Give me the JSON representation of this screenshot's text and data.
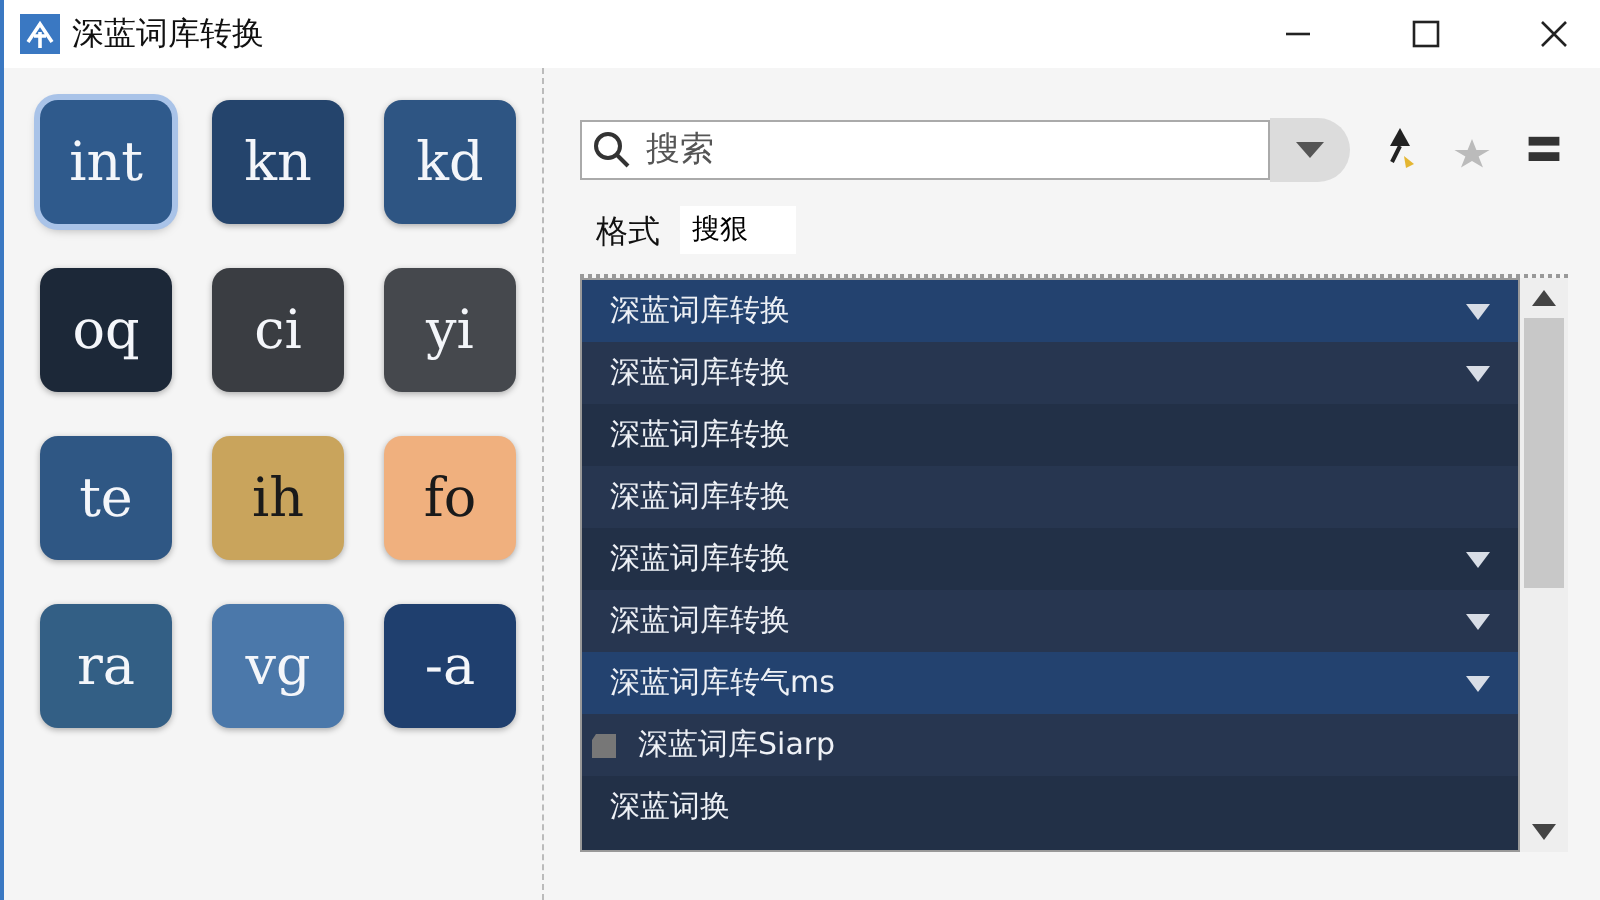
{
  "window": {
    "title": "深蓝词库转换"
  },
  "tiles": [
    {
      "label": "int",
      "color": "#2f5a8c",
      "selected": true
    },
    {
      "label": "kn",
      "color": "#24446c",
      "selected": false
    },
    {
      "label": "kd",
      "color": "#2e5583",
      "selected": false
    },
    {
      "label": "oq",
      "color": "#1c2838",
      "selected": false
    },
    {
      "label": "ci",
      "color": "#3a3d42",
      "selected": false
    },
    {
      "label": "yi",
      "color": "#45484d",
      "selected": false
    },
    {
      "label": "te",
      "color": "#2f5784",
      "selected": false
    },
    {
      "label": "ih",
      "color": "#c9a45c",
      "selected": false
    },
    {
      "label": "fo",
      "color": "#f0b07e",
      "selected": false
    },
    {
      "label": "ra",
      "color": "#335f85",
      "selected": false
    },
    {
      "label": "vg",
      "color": "#4b78aa",
      "selected": false
    },
    {
      "label": "-a",
      "color": "#1f3f6e",
      "selected": false
    }
  ],
  "search": {
    "placeholder": "搜索"
  },
  "format": {
    "label": "格式",
    "value": "搜狠"
  },
  "list": [
    {
      "text": "深蓝词库转换",
      "kind": "folder",
      "selected": true
    },
    {
      "text": "深蓝词库转换",
      "kind": "folder",
      "selected": false
    },
    {
      "text": "深蓝词库转换",
      "kind": "plain",
      "selected": false
    },
    {
      "text": "深蓝词库转换",
      "kind": "plain",
      "selected": false
    },
    {
      "text": "深蓝词库转换",
      "kind": "folder",
      "selected": false
    },
    {
      "text": "深蓝词库转换",
      "kind": "folder",
      "selected": false
    },
    {
      "text": "深蓝词库转气ms",
      "kind": "folder",
      "selected": true
    },
    {
      "text": "深蓝词库Siarp",
      "kind": "file",
      "selected": false
    },
    {
      "text": "深蓝词换",
      "kind": "plain",
      "selected": false
    }
  ]
}
